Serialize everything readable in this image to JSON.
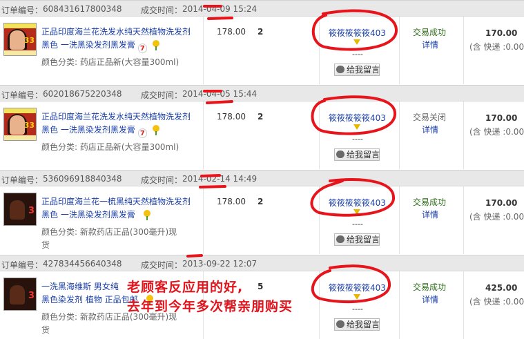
{
  "labels": {
    "order_no": "订单编号：",
    "deal_time": "成交时间：",
    "leave_message": "给我留言",
    "details": "详情",
    "sku_prefix": "颜色分类:",
    "dash": "----",
    "shipping": "(含 快递 :0.00"
  },
  "orders": [
    {
      "order_number": "608431617800348",
      "time": "2014-04-09 15:24",
      "title_line1": "正品印度海兰花洗发水纯天然植物洗发剂",
      "title_line2": "黑色 一洗黑染发剂黑发膏",
      "sku": "药店正品新(大容量300ml)",
      "sku_line2": "",
      "price": "178.00",
      "qty": "2",
      "seller": "筱筱筱筱筱403",
      "status": "交易成功",
      "total": "170.00",
      "thumb_badge": "33"
    },
    {
      "order_number": "602018675220348",
      "time": "2014-04-05 15:44",
      "title_line1": "正品印度海兰花洗发水纯天然植物洗发剂",
      "title_line2": "黑色 一洗黑染发剂黑发膏",
      "sku": "药店正品新(大容量300ml)",
      "sku_line2": "",
      "price": "178.00",
      "qty": "2",
      "seller": "筱筱筱筱筱403",
      "status": "交易关闭",
      "total": "170.00",
      "thumb_badge": "33"
    },
    {
      "order_number": "536096918840348",
      "time": "2014-02-14 14:49",
      "title_line1": "正品印度海兰花一梳黑纯天然植物洗发剂",
      "title_line2": "黑色 一洗黑染发剂黑发膏",
      "sku": "新款药店正品(300毫升)现",
      "sku_line2": "货",
      "price": "178.00",
      "qty": "2",
      "seller": "筱筱筱筱筱403",
      "status": "交易成功",
      "total": "170.00",
      "thumb_badge": "3"
    },
    {
      "order_number": "427834456640348",
      "time": "2013-09-22 12:07",
      "title_line1": "一洗黑海维斯 男女纯",
      "title_line2": "黑色染发剂 植物 正品包邮",
      "sku": "新款药店正品(300毫升)现",
      "sku_line2": "货",
      "price": "",
      "qty": "5",
      "seller": "筱筱筱筱筱403",
      "status": "交易成功",
      "total": "425.00",
      "thumb_badge": "3"
    }
  ],
  "annotation": {
    "line1": "老顾客反应用的好,",
    "line2": "去年到今年多次帮亲朋购买"
  },
  "colors": {
    "link": "#1a3fa8",
    "success": "#2d6d18",
    "annotation_red": "#e0151d"
  }
}
